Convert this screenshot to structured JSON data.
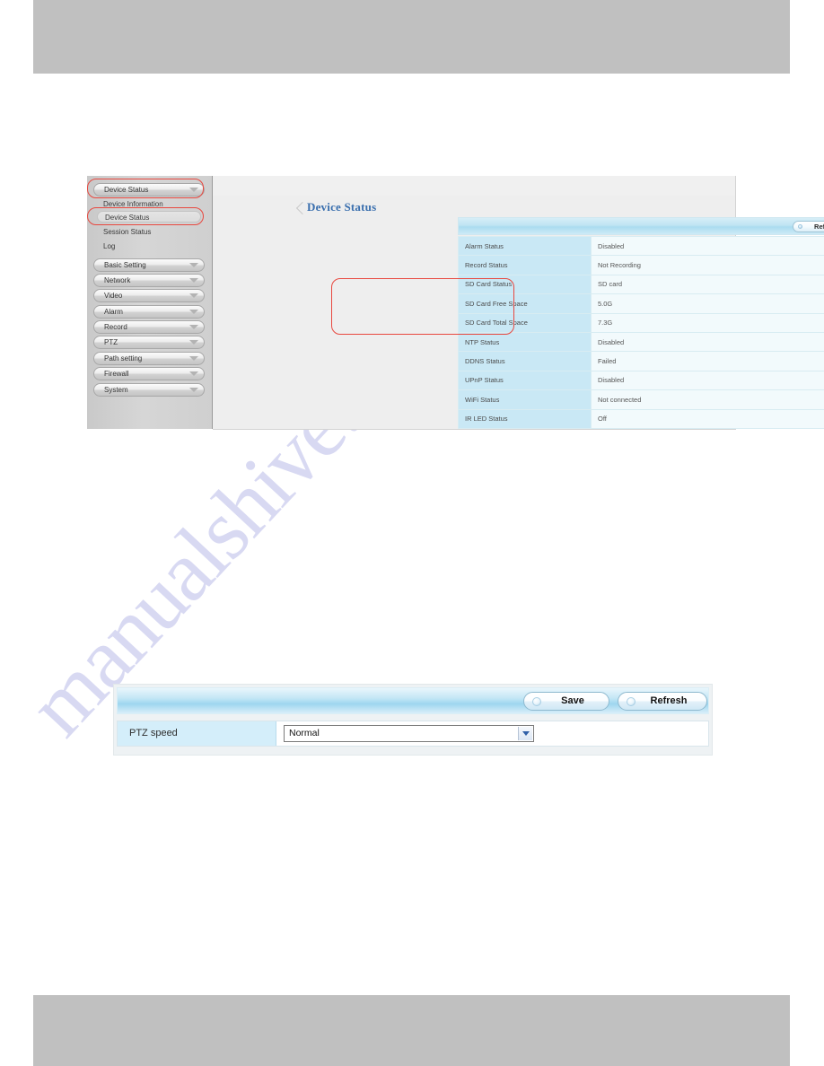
{
  "page": {
    "header_band_color": "#c0c0c0",
    "footer_band_color": "#c0c0c0",
    "watermark_text": "manualshive.com"
  },
  "figure": {
    "heading": "Device Status",
    "sidebar": {
      "group_button": {
        "label": "Device Status"
      },
      "items": [
        {
          "label": "Device Information",
          "selected": false
        },
        {
          "label": "Device Status",
          "selected": true
        },
        {
          "label": "Session Status",
          "selected": false
        },
        {
          "label": "Log",
          "selected": false
        }
      ],
      "groups": [
        {
          "label": "Basic Setting"
        },
        {
          "label": "Network"
        },
        {
          "label": "Video"
        },
        {
          "label": "Alarm"
        },
        {
          "label": "Record"
        },
        {
          "label": "PTZ"
        },
        {
          "label": "Path setting"
        },
        {
          "label": "Firewall"
        },
        {
          "label": "System"
        }
      ]
    },
    "toolbar": {
      "refresh_label": "Refresh",
      "refresh_icon": "refresh-icon"
    },
    "status_table": {
      "rows": [
        {
          "key": "Alarm Status",
          "value": "Disabled"
        },
        {
          "key": "Record Status",
          "value": "Not Recording"
        },
        {
          "key": "SD Card Status",
          "value": "SD card"
        },
        {
          "key": "SD Card Free Space",
          "value": "5.0G"
        },
        {
          "key": "SD Card Total Space",
          "value": "7.3G"
        },
        {
          "key": "NTP Status",
          "value": "Disabled"
        },
        {
          "key": "DDNS Status",
          "value": "Failed"
        },
        {
          "key": "UPnP Status",
          "value": "Disabled"
        },
        {
          "key": "WiFi Status",
          "value": "Not connected"
        },
        {
          "key": "IR LED Status",
          "value": "Off"
        }
      ]
    },
    "annotation_color": "#e8483f"
  },
  "ptz_panel": {
    "save_label": "Save",
    "refresh_label": "Refresh",
    "save_icon": "refresh-circle-icon",
    "refresh_icon": "refresh-circle-icon",
    "speed_label": "PTZ speed",
    "speed_value": "Normal",
    "dropdown_icon": "chevron-down-icon"
  }
}
